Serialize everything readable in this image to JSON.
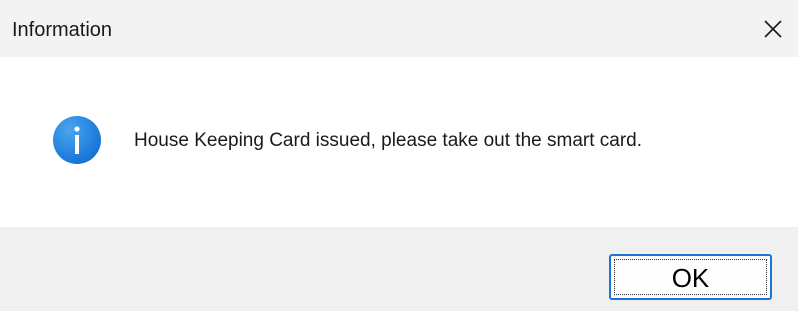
{
  "window": {
    "title": "Information",
    "close_icon": "close-icon"
  },
  "content": {
    "icon": "info-icon",
    "icon_color": "#1f87e5",
    "message": "House Keeping Card issued, please take out the smart card."
  },
  "footer": {
    "ok_label": "OK",
    "accent_color": "#1d73d6"
  }
}
